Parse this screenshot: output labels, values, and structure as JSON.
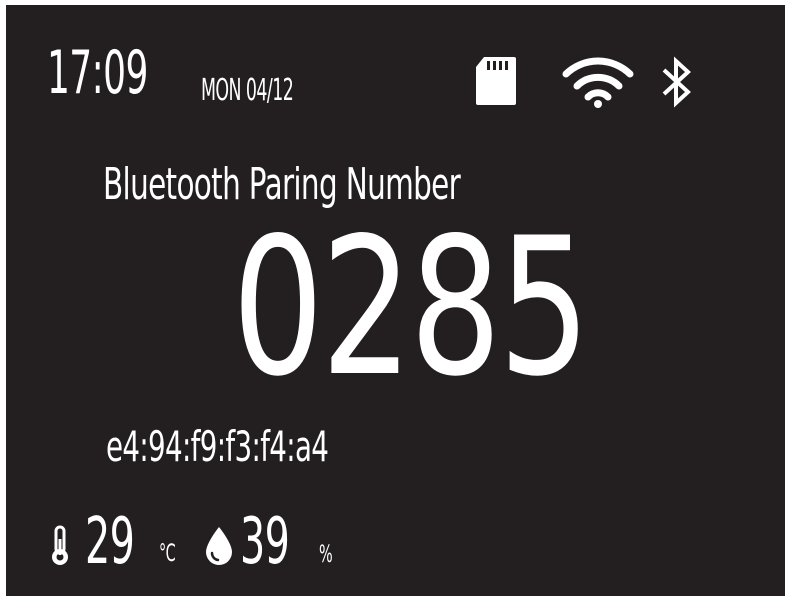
{
  "status_bar": {
    "time": "17:09",
    "date": "MON 04/12",
    "icons": [
      "sd-card-icon",
      "wifi-icon",
      "bluetooth-icon"
    ]
  },
  "pairing": {
    "title": "Bluetooth Paring Number",
    "number": "0285",
    "mac_address": "e4:94:f9:f3:f4:a4"
  },
  "sensors": {
    "temperature": {
      "icon": "thermometer-icon",
      "value": "29",
      "unit": "°C"
    },
    "humidity": {
      "icon": "droplet-icon",
      "value": "39",
      "unit": "%"
    }
  },
  "colors": {
    "background": "#231f20",
    "foreground": "#ffffff"
  }
}
